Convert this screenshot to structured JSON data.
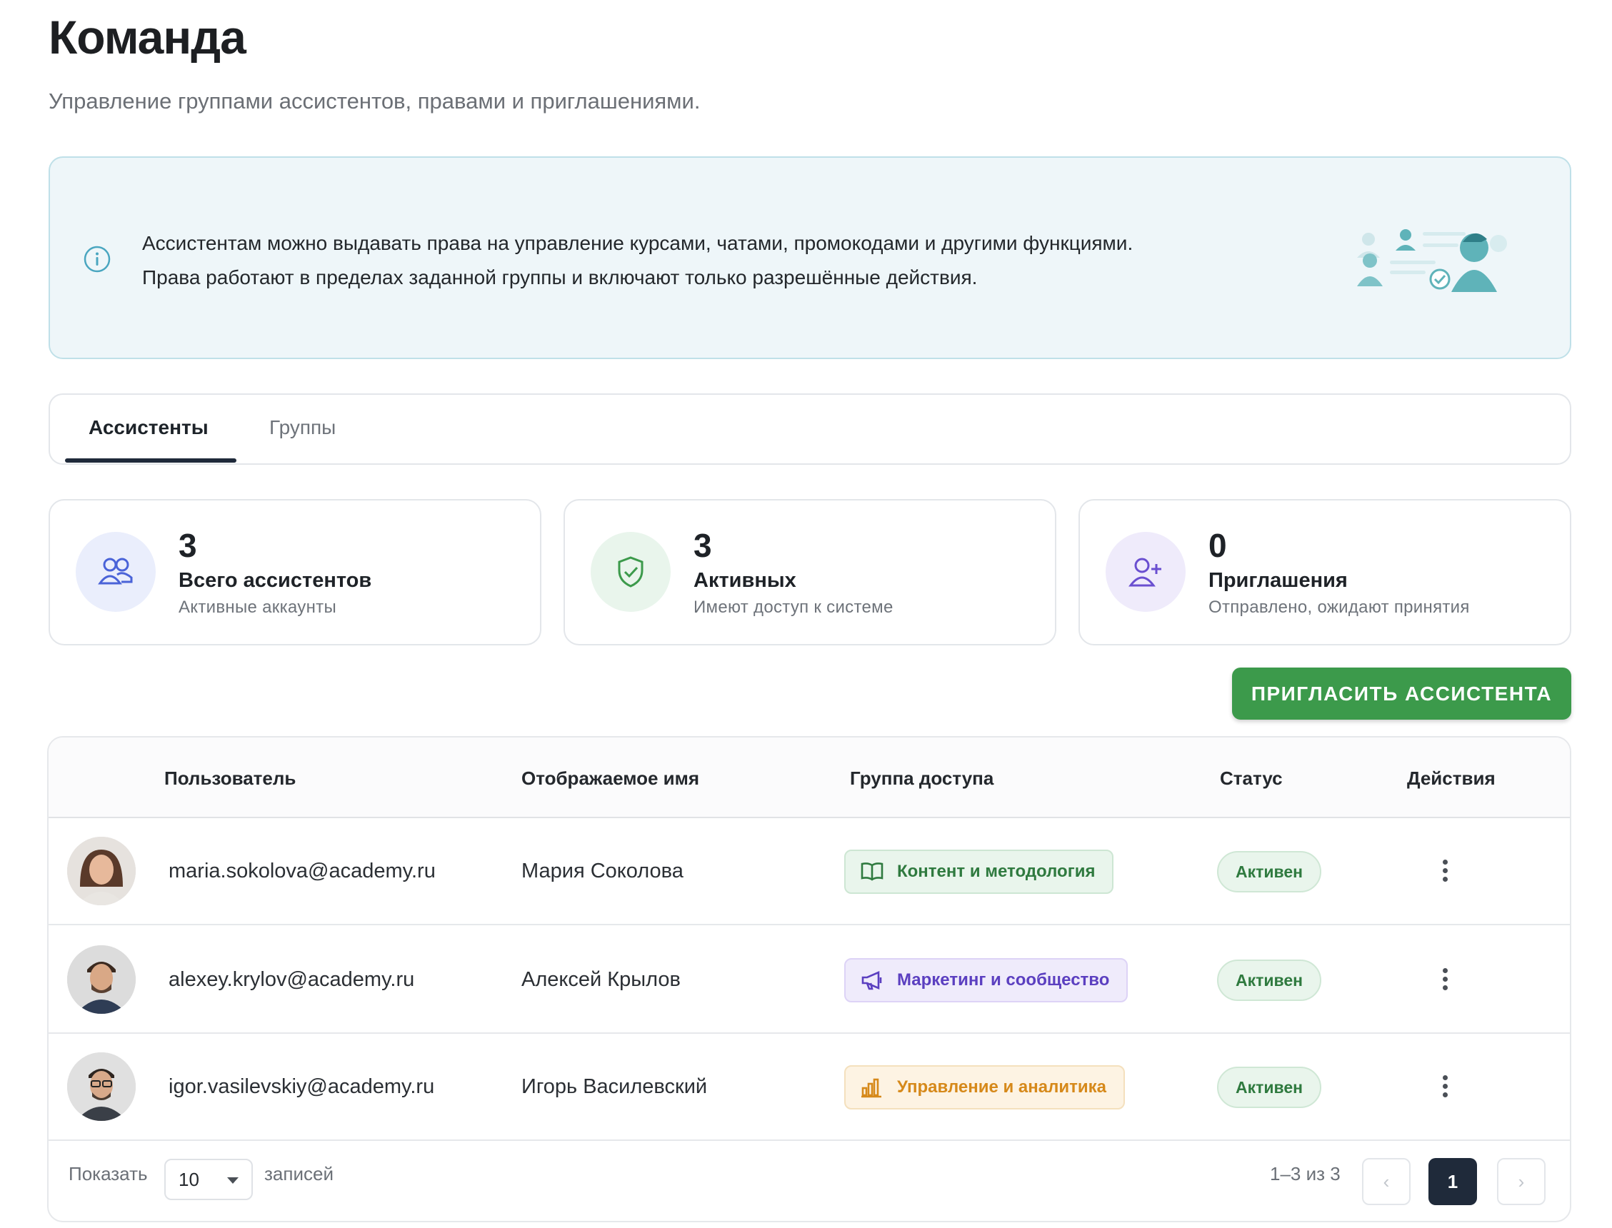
{
  "header": {
    "title": "Команда",
    "subtitle": "Управление группами ассистентов, правами и приглашениями."
  },
  "info": {
    "line1": "Ассистентам можно выдавать права на управление курсами, чатами, промокодами и другими функциями.",
    "line2": "Права работают в пределах заданной группы и включают только разрешённые действия."
  },
  "tabs": [
    {
      "label": "Ассистенты",
      "active": true
    },
    {
      "label": "Группы",
      "active": false
    }
  ],
  "stats": [
    {
      "value": "3",
      "title": "Всего ассистентов",
      "subtitle": "Активные аккаунты",
      "icon": "users-icon",
      "color": "#4a63d8"
    },
    {
      "value": "3",
      "title": "Активных",
      "subtitle": "Имеют доступ к системе",
      "icon": "shield-check-icon",
      "color": "#3c9a4b"
    },
    {
      "value": "0",
      "title": "Приглашения",
      "subtitle": "Отправлено, ожидают принятия",
      "icon": "user-plus-icon",
      "color": "#6a4fd0"
    }
  ],
  "invite_button": "ПРИГЛАСИТЬ АССИСТЕНТА",
  "table": {
    "columns": [
      "Пользователь",
      "Отображаемое имя",
      "Группа доступа",
      "Статус",
      "Действия"
    ],
    "rows": [
      {
        "email": "maria.sokolova@academy.ru",
        "name": "Мария Соколова",
        "group": "Контент и методология",
        "group_icon": "book-icon",
        "status": "Активен"
      },
      {
        "email": "alexey.krylov@academy.ru",
        "name": "Алексей Крылов",
        "group": "Маркетинг и сообщество",
        "group_icon": "megaphone-icon",
        "status": "Активен"
      },
      {
        "email": "igor.vasilevskiy@academy.ru",
        "name": "Игорь Василевский",
        "group": "Управление и аналитика",
        "group_icon": "bar-chart-icon",
        "status": "Активен"
      }
    ]
  },
  "pagination": {
    "show_label": "Показать",
    "page_size": "10",
    "records_label": "записей",
    "range": "1–3 из 3",
    "current_page": "1",
    "prev": "‹",
    "next": "›"
  },
  "colors": {
    "primary_green": "#3c9a4b",
    "dark_navy": "#1f2a3a",
    "info_bg": "#eef6f9"
  }
}
